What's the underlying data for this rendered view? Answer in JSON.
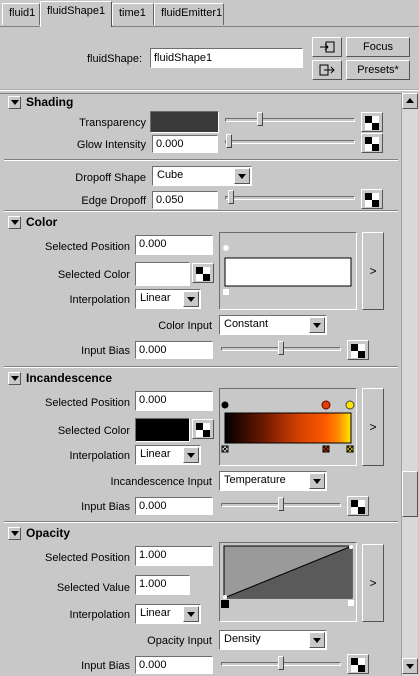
{
  "tabs": [
    "fluid1",
    "fluidShape1",
    "time1",
    "fluidEmitter1"
  ],
  "header": {
    "shape_label": "fluidShape:",
    "shape_value": "fluidShape1",
    "focus_label": "Focus",
    "presets_label": "Presets*"
  },
  "shading": {
    "title": "Shading",
    "transparency_label": "Transparency",
    "transparency_color": "#3a3a3a",
    "glow_label": "Glow Intensity",
    "glow_value": "0.000",
    "dropoff_shape_label": "Dropoff Shape",
    "dropoff_shape_value": "Cube",
    "edge_dropoff_label": "Edge Dropoff",
    "edge_dropoff_value": "0.050"
  },
  "color": {
    "title": "Color",
    "sel_pos_label": "Selected Position",
    "sel_pos_value": "0.000",
    "sel_color_label": "Selected Color",
    "sel_color": "#ffffff",
    "interp_label": "Interpolation",
    "interp_value": "Linear",
    "input_label": "Color Input",
    "input_value": "Constant",
    "bias_label": "Input Bias",
    "bias_value": "0.000"
  },
  "incandescence": {
    "title": "Incandescence",
    "sel_pos_label": "Selected Position",
    "sel_pos_value": "0.000",
    "sel_color_label": "Selected Color",
    "sel_color": "#000000",
    "interp_label": "Interpolation",
    "interp_value": "Linear",
    "input_label": "Incandescence Input",
    "input_value": "Temperature",
    "bias_label": "Input Bias",
    "bias_value": "0.000"
  },
  "opacity": {
    "title": "Opacity",
    "sel_pos_label": "Selected Position",
    "sel_pos_value": "1.000",
    "sel_value_label": "Selected Value",
    "sel_value": "1.000",
    "interp_label": "Interpolation",
    "interp_value": "Linear",
    "input_label": "Opacity Input",
    "input_value": "Density",
    "bias_label": "Input Bias",
    "bias_value": "0.000"
  },
  "expand_label": ">"
}
